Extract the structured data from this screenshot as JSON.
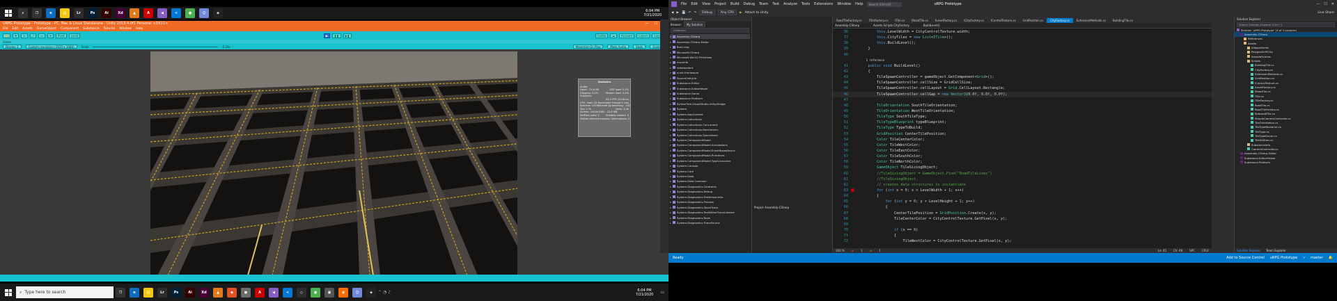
{
  "unity": {
    "title": "URPG Prototype - Prototype - PC, Mac & Linux Standalone - Unity 2019.4.0f1 Personal <DX11>",
    "menu": [
      "File",
      "Edit",
      "Assets",
      "GameObject",
      "Component",
      "Substance",
      "Tutorial",
      "Window",
      "Help"
    ],
    "toolbar": {
      "pivot": "Pivot",
      "local": "Local",
      "collab": "Collab",
      "account": "Account",
      "layers": "Layers",
      "layout": "Layout"
    },
    "tab_game": "Game",
    "gamebar": {
      "display": "Display 1",
      "resolution": "Custom resolution (1920 x 1080)",
      "scale_label": "Scale",
      "scale_value": "0.34x",
      "maximize": "Maximize On Play",
      "mute": "Mute Audio",
      "stats": "Stats",
      "gizmos": "Gizmos"
    },
    "stats": {
      "title": "Statistics",
      "audio_h": "Audio:",
      "level": "Level: -74.8 dB",
      "dsp": "DSP load: 0.2%",
      "clipping": "Clipping: 0.0%",
      "stream": "Stream load: 0.0%",
      "graphics_h": "Graphics:",
      "fps": "44.2 FPS (22.6ms)",
      "cpu": "CPU: main 22.6ms",
      "render": "render thread 2.1ms",
      "batches": "Batches: 14298",
      "saved": "Saved by batching: -142",
      "tris": "Tris: 1.7k",
      "verts": "Verts: 3.4k",
      "screen": "Screen: 1920x1080 - 23.4 MB",
      "setpass": "SetPass calls: 0",
      "shadow": "Shadow casters: 0",
      "skinned": "Visible skinned meshes: 0",
      "anims": "Animations: 0"
    }
  },
  "taskbar_left": {
    "search": "Type here to search",
    "time": "6:04 PM",
    "date": "7/21/2020"
  },
  "vs": {
    "menu": [
      "File",
      "Edit",
      "View",
      "Project",
      "Build",
      "Debug",
      "Team",
      "Test",
      "Analyze",
      "Tools",
      "Extensions",
      "Window",
      "Help"
    ],
    "search_placeholder": "Search (Ctrl+Q)",
    "project_name": "uRPG Prototype",
    "live_share": "Live Share",
    "toolbar": {
      "config": "Debug",
      "platform": "Any CPU",
      "attach": "Attach to Unity"
    },
    "object_browser": {
      "title": "Object Browser",
      "browse_label": "Browse:",
      "browse_value": "My Solution",
      "search_placeholder": "<Search>",
      "items": [
        "Assembly-CSharp",
        "Assembly-CSharp-Editor",
        "Boo.Lang",
        "Microsoft.CSharp",
        "Microsoft.Win32.Primitives",
        "mscorlib",
        "netstandard",
        "nunit.framework",
        "SourceUnityLib",
        "Substance.Editor",
        "Substance.EditorHelper",
        "Substance.Game",
        "Substance.Platform",
        "SyntaxTree.VisualStudio.Unity.Bridge",
        "System",
        "System.AppContext",
        "System.Collections",
        "System.Collections.Concurrent",
        "System.Collections.NonGeneric",
        "System.Collections.Specialized",
        "System.ComponentModel",
        "System.ComponentModel.Annotations",
        "System.ComponentModel.EventBasedAsync",
        "System.ComponentModel.Primitives",
        "System.ComponentModel.TypeConverter",
        "System.Console",
        "System.Core",
        "System.Data",
        "System.Data.Common",
        "System.Diagnostics.Contracts",
        "System.Diagnostics.Debug",
        "System.Diagnostics.FileVersionInfo",
        "System.Diagnostics.Process",
        "System.Diagnostics.StackTrace",
        "System.Diagnostics.TextWriterTraceListener",
        "System.Diagnostics.Tools",
        "System.Diagnostics.TraceSource"
      ],
      "project_label": "Project Assembly-CSharp"
    },
    "tabs": [
      "RoadTileFactory.cs",
      "ITileFactory.cs",
      "ITile.cs",
      "IRoadTile.cs",
      "ILevelFactory.cs",
      "ICityFactory.cs",
      "IControlTexture.cs",
      "GridPosition.cs",
      "CityFactory.cs",
      "ExtensionMethods.cs",
      "BuildingTile.cs"
    ],
    "active_tab": 8,
    "nav": {
      "project": "Assembly-CSharp",
      "class": "Assets.Scripts.CityFactory",
      "method": "BuildLevel()"
    },
    "code_lines": [
      {
        "n": "36",
        "t": "        this.LevelWidth = CityControlTexture.width;"
      },
      {
        "n": "37",
        "t": "        this.CityTiles = new List<ITile>();"
      },
      {
        "n": "38",
        "t": "        this.BuildLevel();"
      },
      {
        "n": "39",
        "t": "    }"
      },
      {
        "n": "40",
        "t": ""
      },
      {
        "n": "",
        "t": "    1 reference"
      },
      {
        "n": "41",
        "t": "    public void BuildLevel()"
      },
      {
        "n": "42",
        "t": "    {"
      },
      {
        "n": "43",
        "t": "        TileSpawnController = gameObject.GetComponent<Grid>();"
      },
      {
        "n": "44",
        "t": "        TileSpawnController.cellSize = GridCellSize;"
      },
      {
        "n": "45",
        "t": "        TileSpawnController.cellLayout = Grid.CellLayout.Rectangle;"
      },
      {
        "n": "46",
        "t": "        TileSpawnController.cellGap = new Vector3(0.0f, 0.0f, 0.0f);"
      },
      {
        "n": "47",
        "t": ""
      },
      {
        "n": "48",
        "t": "        TileOrientation SouthTileOrientation;"
      },
      {
        "n": "49",
        "t": "        TileOrientation WestTileOrientation;"
      },
      {
        "n": "50",
        "t": "        TileType SouthTileType;"
      },
      {
        "n": "51",
        "t": "        TileTypeBlueprint typeBlueprint;"
      },
      {
        "n": "52",
        "t": "        TileType TypeToBuild;"
      },
      {
        "n": "53",
        "t": "        GridPosition CenterTilePosition;"
      },
      {
        "n": "54",
        "t": "        Color TileCenterColor;"
      },
      {
        "n": "55",
        "t": "        Color TileWestColor;"
      },
      {
        "n": "56",
        "t": "        Color TileEastColor;"
      },
      {
        "n": "57",
        "t": "        Color TileSouthColor;"
      },
      {
        "n": "58",
        "t": "        Color TileNorthColor;"
      },
      {
        "n": "59",
        "t": "        GameObject TileSizingObject;"
      },
      {
        "n": "60",
        "t": "        //TileSizingObject = GameObject.Find(\"RoadTileLines\")"
      },
      {
        "n": "61",
        "t": "        //TileSizingObject."
      },
      {
        "n": "62",
        "t": "        // creates data structures to instantiate"
      },
      {
        "n": "63",
        "t": "        for (int x = 0; x < LevelWidth + 1; x++)"
      },
      {
        "n": "64",
        "t": "        {"
      },
      {
        "n": "65",
        "t": "            for (int y = 0; y < LevelHeight + 1; y++)"
      },
      {
        "n": "66",
        "t": "            {"
      },
      {
        "n": "67",
        "t": "                CenterTilePosition = GridPosition.Create(x, y);"
      },
      {
        "n": "68",
        "t": "                TileCenterColor = CityControlTexture.GetPixel(x, y);"
      },
      {
        "n": "69",
        "t": ""
      },
      {
        "n": "70",
        "t": "                if (x == 0)"
      },
      {
        "n": "71",
        "t": "                {"
      },
      {
        "n": "72",
        "t": "                    TileWestColor = CityControlTexture.GetPixel(x, y);"
      }
    ],
    "editor_status": {
      "zoom": "100 %",
      "errors": "1",
      "warnings": "1",
      "ln": "Ln: 45",
      "ch": "Ch: 48",
      "mode": "SPC",
      "eol": "CRLF"
    },
    "solution_explorer": {
      "title": "Solution Explorer",
      "search_placeholder": "Search Solution Explorer (Ctrl+;)",
      "items": [
        {
          "d": 0,
          "t": "Solution 'uRPG Prototype' (4 of 4 projects)"
        },
        {
          "d": 1,
          "t": "Assembly-CSharp",
          "sel": true
        },
        {
          "d": 2,
          "t": "References"
        },
        {
          "d": 2,
          "t": "Assets"
        },
        {
          "d": 3,
          "t": "AllegorithmIc"
        },
        {
          "d": 3,
          "t": "PolygonSciFiCity"
        },
        {
          "d": 3,
          "t": "SampleScenes"
        },
        {
          "d": 3,
          "t": "Scripts"
        },
        {
          "d": 4,
          "t": "BuildingTile.cs"
        },
        {
          "d": 4,
          "t": "CityFactory.cs"
        },
        {
          "d": 4,
          "t": "ExtensionMethods.cs"
        },
        {
          "d": 4,
          "t": "GridPosition.cs"
        },
        {
          "d": 4,
          "t": "IControlTexture.cs"
        },
        {
          "d": 4,
          "t": "ILevelFactory.cs"
        },
        {
          "d": 4,
          "t": "IRoadTile.cs"
        },
        {
          "d": 4,
          "t": "ITile.cs"
        },
        {
          "d": 4,
          "t": "ITileFactory.cs"
        },
        {
          "d": 4,
          "t": "RoadTile.cs"
        },
        {
          "d": 4,
          "t": "RoadTileFactory.cs"
        },
        {
          "d": 4,
          "t": "SidewalkTile.cs"
        },
        {
          "d": 4,
          "t": "SimpleCameraController.cs"
        },
        {
          "d": 4,
          "t": "TileOrientation.cs"
        },
        {
          "d": 4,
          "t": "TileTypeBlueprint.cs"
        },
        {
          "d": 4,
          "t": "TileType.cs"
        },
        {
          "d": 4,
          "t": "TileTypeEnum.cs"
        },
        {
          "d": 4,
          "t": "TileUtilities.cs"
        },
        {
          "d": 3,
          "t": "SubstanceInfo"
        },
        {
          "d": 3,
          "t": "CameraController.cs"
        },
        {
          "d": 1,
          "t": "Assembly-CSharp-Editor"
        },
        {
          "d": 1,
          "t": "Substance.EditorHelper"
        },
        {
          "d": 1,
          "t": "Substance.Platform"
        }
      ],
      "tab_active": "Solution Explorer",
      "tab_other": "Team Explorer"
    },
    "statusbar": {
      "ready": "Ready",
      "source": "Add to Source Control",
      "project": "uRPG Prototype",
      "branch": "master"
    }
  },
  "taskbar_right": {
    "time": "6:04 PM",
    "date": "7/21/2020"
  },
  "colors": {
    "unity_accent": "#ef6a24",
    "unity_toolbar": "#19c2cf",
    "vs_accent": "#007acc",
    "road_line": "#c8a11e"
  }
}
